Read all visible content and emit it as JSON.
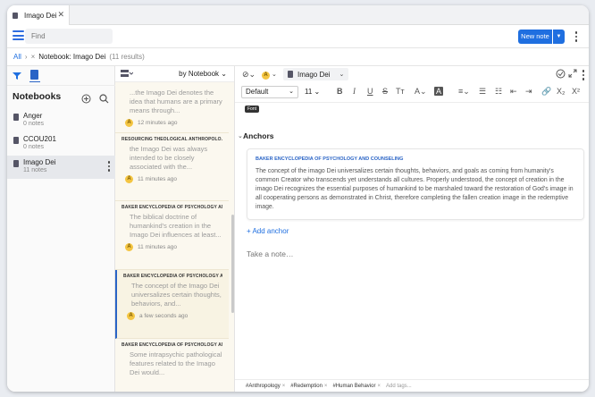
{
  "tab": {
    "title": "Imago Dei"
  },
  "toolbar": {
    "search_placeholder": "Find",
    "new_note_label": "New note"
  },
  "breadcrumb": {
    "root": "All",
    "current": "Notebook: Imago Dei",
    "count": "(11 results)"
  },
  "sidebar": {
    "title": "Notebooks",
    "items": [
      {
        "name": "Anger",
        "count": "0 notes"
      },
      {
        "name": "CCOU201",
        "count": "0 notes"
      },
      {
        "name": "Imago Dei",
        "count": "11 notes"
      }
    ]
  },
  "notes_list": {
    "sort_label": "by Notebook",
    "items": [
      {
        "source": "",
        "snippet": "...the Imago Dei denotes the idea that humans are a primary means through...",
        "time": "12 minutes ago"
      },
      {
        "source": "RESOURCING THEOLOGICAL ANTHROPOLO...",
        "snippet": "the Imago Dei was always intended to be closely associated with the...",
        "time": "11 minutes ago"
      },
      {
        "source": "BAKER ENCYCLOPEDIA OF PSYCHOLOGY AN...",
        "snippet": "The biblical doctrine of humankind's creation in the Imago Dei influences at least...",
        "time": "11 minutes ago"
      },
      {
        "source": "BAKER ENCYCLOPEDIA OF PSYCHOLOGY AN...",
        "snippet": "The concept of the Imago Dei universalizes certain thoughts, behaviors, and...",
        "time": "a few seconds ago"
      },
      {
        "source": "BAKER ENCYCLOPEDIA OF PSYCHOLOGY AN...",
        "snippet": "Some intrapsychic pathological features related to the Imago Dei would...",
        "time": ""
      }
    ]
  },
  "editor": {
    "notebook_label": "Imago Dei",
    "font": "Default",
    "size": "11",
    "tooltip": "Font",
    "anchors_title": "Anchors",
    "anchor": {
      "source": "BAKER ENCYCLOPEDIA OF PSYCHOLOGY AND COUNSELING",
      "text": "The concept of the imago Dei universalizes certain thoughts, behaviors, and goals as coming from humanity's common Creator who transcends yet understands all cultures. Properly understood, the concept of creation in the imago Dei recognizes the essential purposes of humankind to be marshaled toward the restoration of God's image in all cooperating persons as demonstrated in Christ, therefore completing the fallen creation image in the redemptive image."
    },
    "add_anchor": "+ Add anchor",
    "note_placeholder": "Take a note…",
    "tags": [
      "#Anthropology",
      "#Redemption",
      "#Human Behavior"
    ],
    "add_tags": "Add tags..."
  },
  "colors": {
    "accent": "#1f6fe0",
    "badge": "#f4c542",
    "note_bg": "#fbf8ef"
  }
}
